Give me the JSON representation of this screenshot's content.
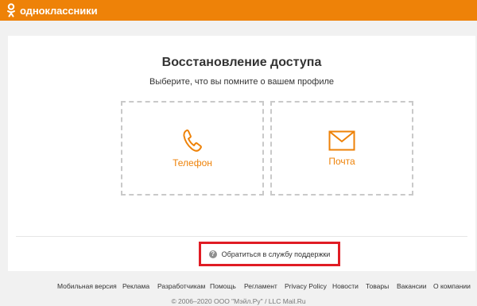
{
  "header": {
    "logo_text": "одноклассники",
    "logo_icon": "ok-logo-icon",
    "brand_color": "#ee8208"
  },
  "main": {
    "title": "Восстановление доступа",
    "subtitle": "Выберите, что вы помните о вашем профиле",
    "options": [
      {
        "label": "Телефон",
        "icon": "phone-icon"
      },
      {
        "label": "Почта",
        "icon": "mail-icon"
      }
    ],
    "support_link": "Обратиться в службу поддержки",
    "highlight_color": "#e01c24"
  },
  "footer": {
    "links": [
      "Мобильная версия",
      "Реклама",
      "Разработчикам",
      "Помощь",
      "Регламент",
      "Privacy Policy",
      "Новости",
      "Товары",
      "Вакансии",
      "О компании"
    ],
    "copyright": "© 2006–2020 ООО \"Мэйл.Ру\" / LLC Mail.Ru"
  }
}
